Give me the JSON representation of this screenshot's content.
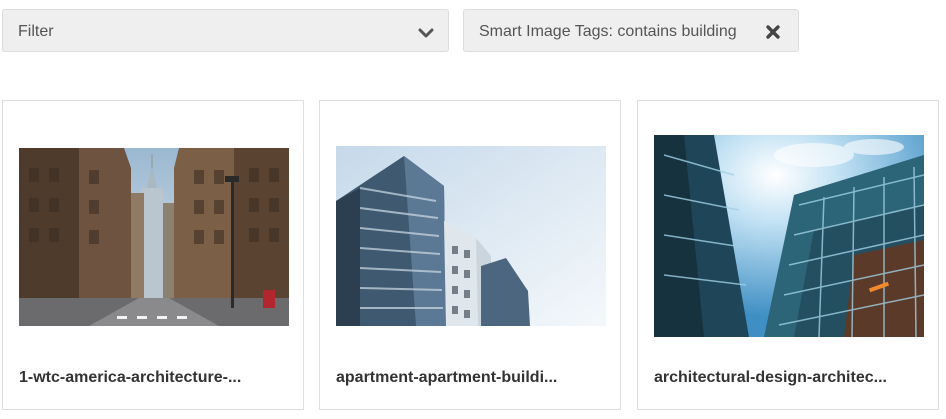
{
  "filter": {
    "placeholder": "Filter",
    "icon": "chevron-down-icon"
  },
  "active_tag": {
    "label": "Smart Image Tags: contains building",
    "icon": "close-icon"
  },
  "images": [
    {
      "caption": "1-wtc-america-architecture-..."
    },
    {
      "caption": "apartment-apartment-buildi..."
    },
    {
      "caption": "architectural-design-architec..."
    }
  ],
  "colors": {
    "chip_bg": "#efefef",
    "border": "#dedede",
    "text": "#333333"
  }
}
